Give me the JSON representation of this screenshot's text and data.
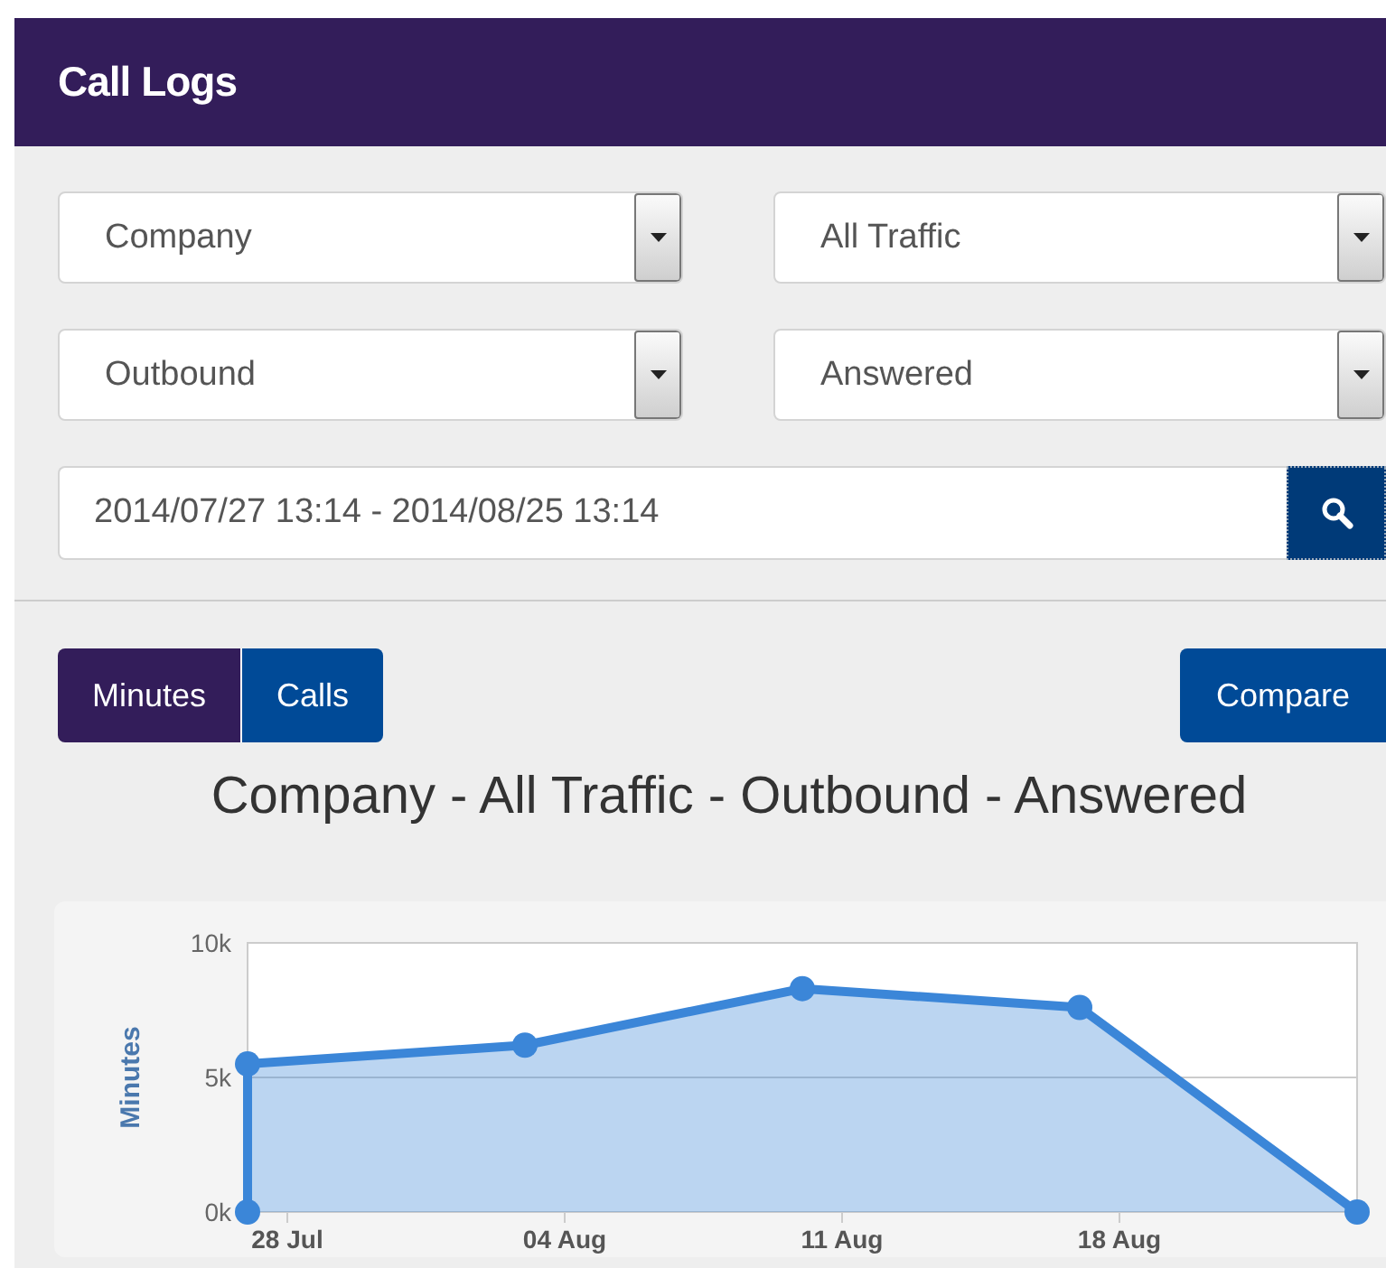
{
  "header": {
    "title": "Call Logs"
  },
  "filters": [
    {
      "value": "Company"
    },
    {
      "value": "All Traffic"
    },
    {
      "value": "Outbound"
    },
    {
      "value": "Answered"
    }
  ],
  "date_range": {
    "value": "2014/07/27 13:14 - 2014/08/25 13:14"
  },
  "view_toggle": [
    {
      "label": "Minutes",
      "selected": true
    },
    {
      "label": "Calls",
      "selected": false
    }
  ],
  "compare_button": {
    "label": "Compare"
  },
  "chart": {
    "title": "Company - All Traffic - Outbound - Answered",
    "chart_data": {
      "type": "area",
      "ylabel": "Minutes",
      "categories": [
        "28 Jul",
        "04 Aug",
        "11 Aug",
        "18 Aug",
        null
      ],
      "series": [
        {
          "color": "#3b86d8",
          "values": [
            5500,
            6200,
            8300,
            7600,
            0
          ]
        }
      ],
      "ylim": [
        0,
        10000
      ],
      "yticks": [
        {
          "value": 0,
          "label": "0k"
        },
        {
          "value": 5000,
          "label": "5k"
        },
        {
          "value": 10000,
          "label": "10k"
        }
      ]
    }
  }
}
